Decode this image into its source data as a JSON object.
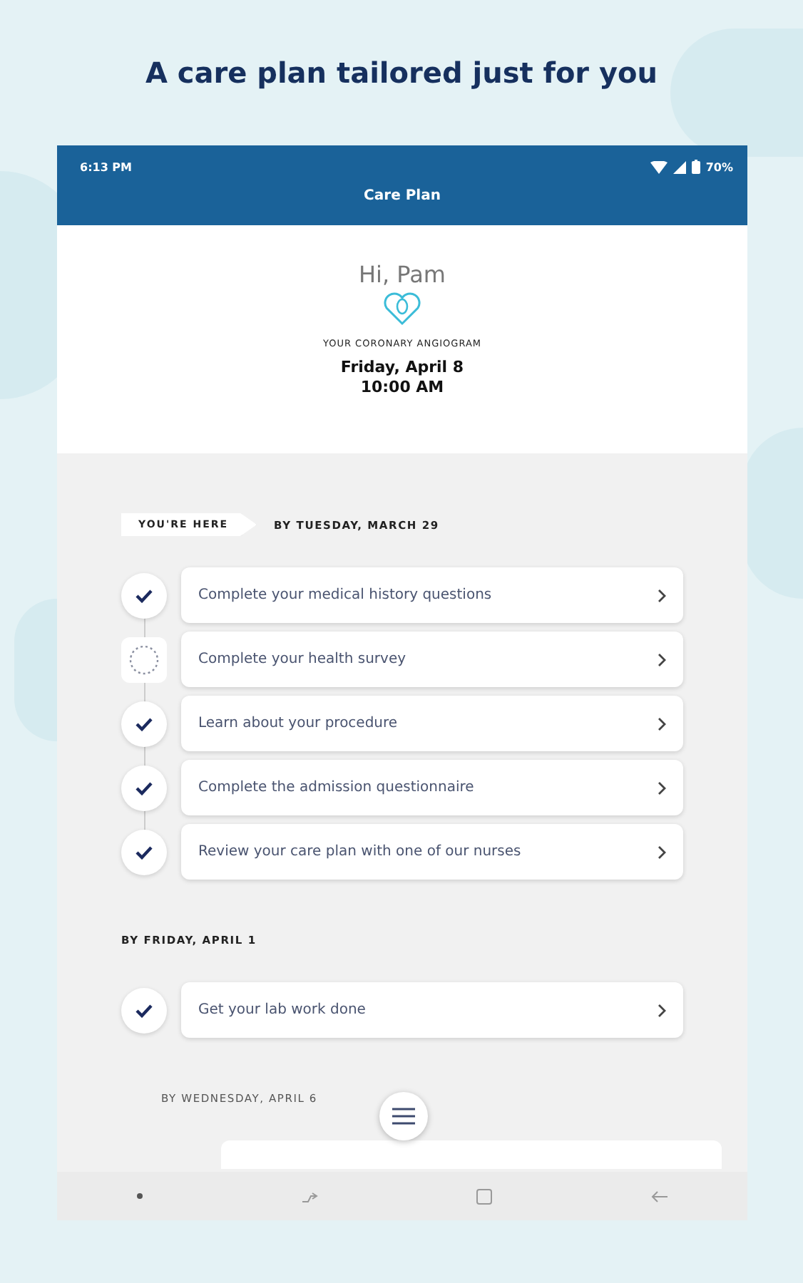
{
  "headline": "A care plan tailored just for you",
  "status_bar": {
    "time": "6:13 PM",
    "battery": "70%"
  },
  "app_bar": {
    "title": "Care Plan"
  },
  "greeting": {
    "text": "Hi, Pam",
    "procedure": "YOUR CORONARY ANGIOGRAM",
    "date": "Friday, April 8",
    "time": "10:00 AM"
  },
  "groups": [
    {
      "heading": "BY TUESDAY, MARCH 29",
      "marker": "YOU'RE HERE",
      "tasks": [
        {
          "label": "Complete your medical history questions",
          "done": true
        },
        {
          "label": "Complete your health survey",
          "done": false
        },
        {
          "label": "Learn about your procedure",
          "done": true
        },
        {
          "label": "Complete the admission questionnaire",
          "done": true
        },
        {
          "label": "Review your care plan with one of our nurses",
          "done": true
        }
      ]
    },
    {
      "heading": "BY FRIDAY, APRIL 1",
      "tasks": [
        {
          "label": "Get your lab work done",
          "done": true
        }
      ]
    },
    {
      "heading": "BY WEDNESDAY, APRIL 6",
      "faded": true
    }
  ]
}
